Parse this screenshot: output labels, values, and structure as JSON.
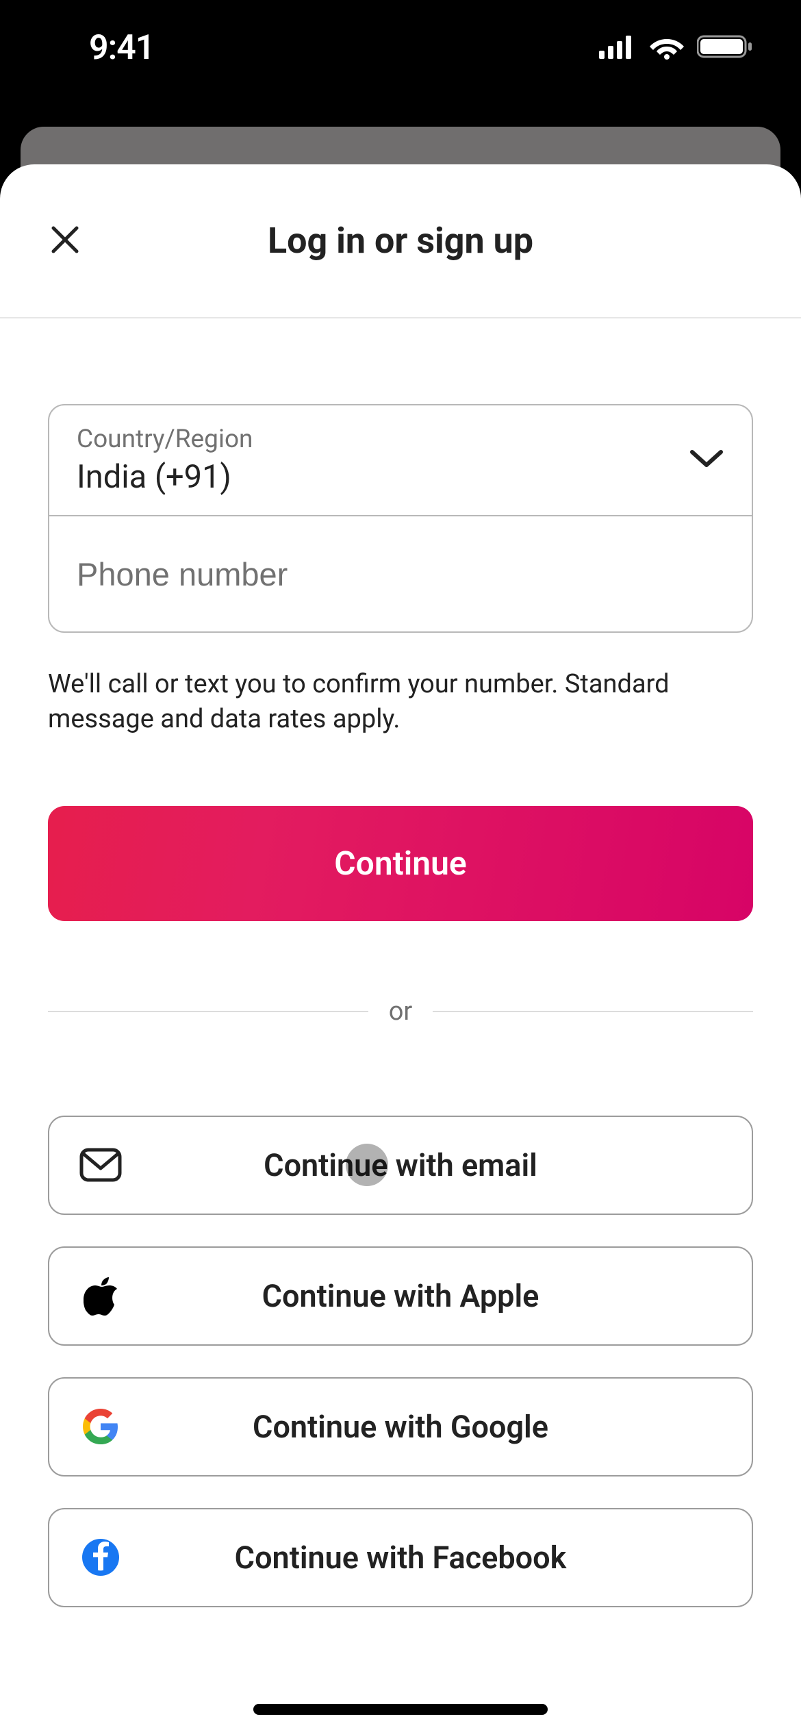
{
  "status": {
    "time": "9:41"
  },
  "sheet": {
    "title": "Log in or sign up"
  },
  "country": {
    "label": "Country/Region",
    "value": "India (+91)"
  },
  "phone": {
    "placeholder": "Phone number"
  },
  "disclaimer": "We'll call or text you to confirm your number. Standard message and data rates apply.",
  "continue_label": "Continue",
  "divider": "or",
  "social": {
    "email": "Continue with email",
    "apple": "Continue with Apple",
    "google": "Continue with Google",
    "facebook": "Continue with Facebook"
  }
}
